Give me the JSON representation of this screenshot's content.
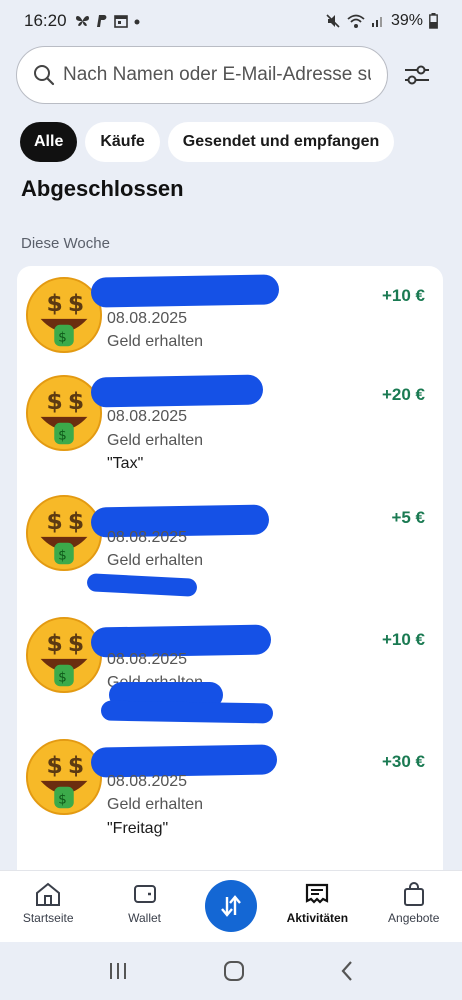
{
  "status_bar": {
    "time": "16:20",
    "battery": "39%"
  },
  "search": {
    "placeholder": "Nach Namen oder E-Mail-Adresse su..."
  },
  "filters": [
    "Alle",
    "Käufe",
    "Gesendet und empfangen"
  ],
  "section_title": "Abgeschlossen",
  "week_label": "Diese Woche",
  "transactions": [
    {
      "date": "08.08.2025",
      "type": "Geld erhalten",
      "note": "",
      "amount": "+10 €"
    },
    {
      "date": "08.08.2025",
      "type": "Geld erhalten",
      "note": "\"Tax\"",
      "amount": "+20 €"
    },
    {
      "date": "08.08.2025",
      "type": "Geld erhalten",
      "note": "",
      "amount": "+5 €"
    },
    {
      "date": "08.08.2025",
      "type": "Geld erhalten",
      "note": "",
      "amount": "+10 €"
    },
    {
      "date": "08.08.2025",
      "type": "Geld erhalten",
      "note": "\"Freitag\"",
      "amount": "+30 €"
    }
  ],
  "bottom_nav": {
    "home": "Startseite",
    "wallet": "Wallet",
    "activity": "Aktivitäten",
    "offers": "Angebote"
  },
  "colors": {
    "accent": "#1467d4",
    "positive": "#1a7a52",
    "redaction": "#1551e6"
  }
}
